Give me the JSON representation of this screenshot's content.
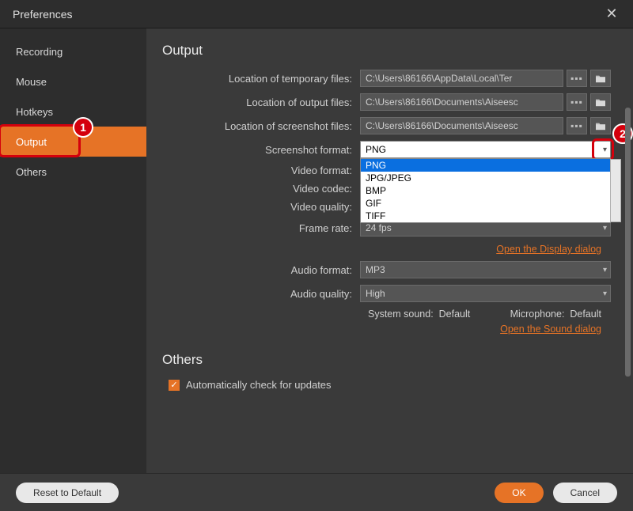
{
  "window": {
    "title": "Preferences"
  },
  "sidebar": {
    "items": [
      {
        "label": "Recording"
      },
      {
        "label": "Mouse"
      },
      {
        "label": "Hotkeys"
      },
      {
        "label": "Output"
      },
      {
        "label": "Others"
      }
    ],
    "active_index": 3
  },
  "annotations": {
    "a1": "1",
    "a2": "2"
  },
  "main": {
    "section_output": "Output",
    "section_others": "Others",
    "labels": {
      "temp_files": "Location of temporary files:",
      "output_files": "Location of output files:",
      "screenshot_files": "Location of screenshot files:",
      "screenshot_format": "Screenshot format:",
      "video_format": "Video format:",
      "video_codec": "Video codec:",
      "video_quality": "Video quality:",
      "frame_rate": "Frame rate:",
      "audio_format": "Audio format:",
      "audio_quality": "Audio quality:",
      "system_sound": "System sound:",
      "microphone": "Microphone:"
    },
    "values": {
      "temp_files": "C:\\Users\\86166\\AppData\\Local\\Ter",
      "output_files": "C:\\Users\\86166\\Documents\\Aiseesc",
      "screenshot_files": "C:\\Users\\86166\\Documents\\Aiseesc",
      "screenshot_format": "PNG",
      "frame_rate": "24 fps",
      "audio_format": "MP3",
      "audio_quality": "High",
      "system_sound": "Default",
      "microphone": "Default"
    },
    "browse_btn": "▪▪▪",
    "screenshot_format_options": [
      "PNG",
      "JPG/JPEG",
      "BMP",
      "GIF",
      "TIFF"
    ],
    "links": {
      "display": "Open the Display dialog",
      "sound": "Open the Sound dialog"
    },
    "checkbox_label": "Automatically check for updates",
    "checkbox_checked": true
  },
  "footer": {
    "reset": "Reset to Default",
    "ok": "OK",
    "cancel": "Cancel"
  }
}
